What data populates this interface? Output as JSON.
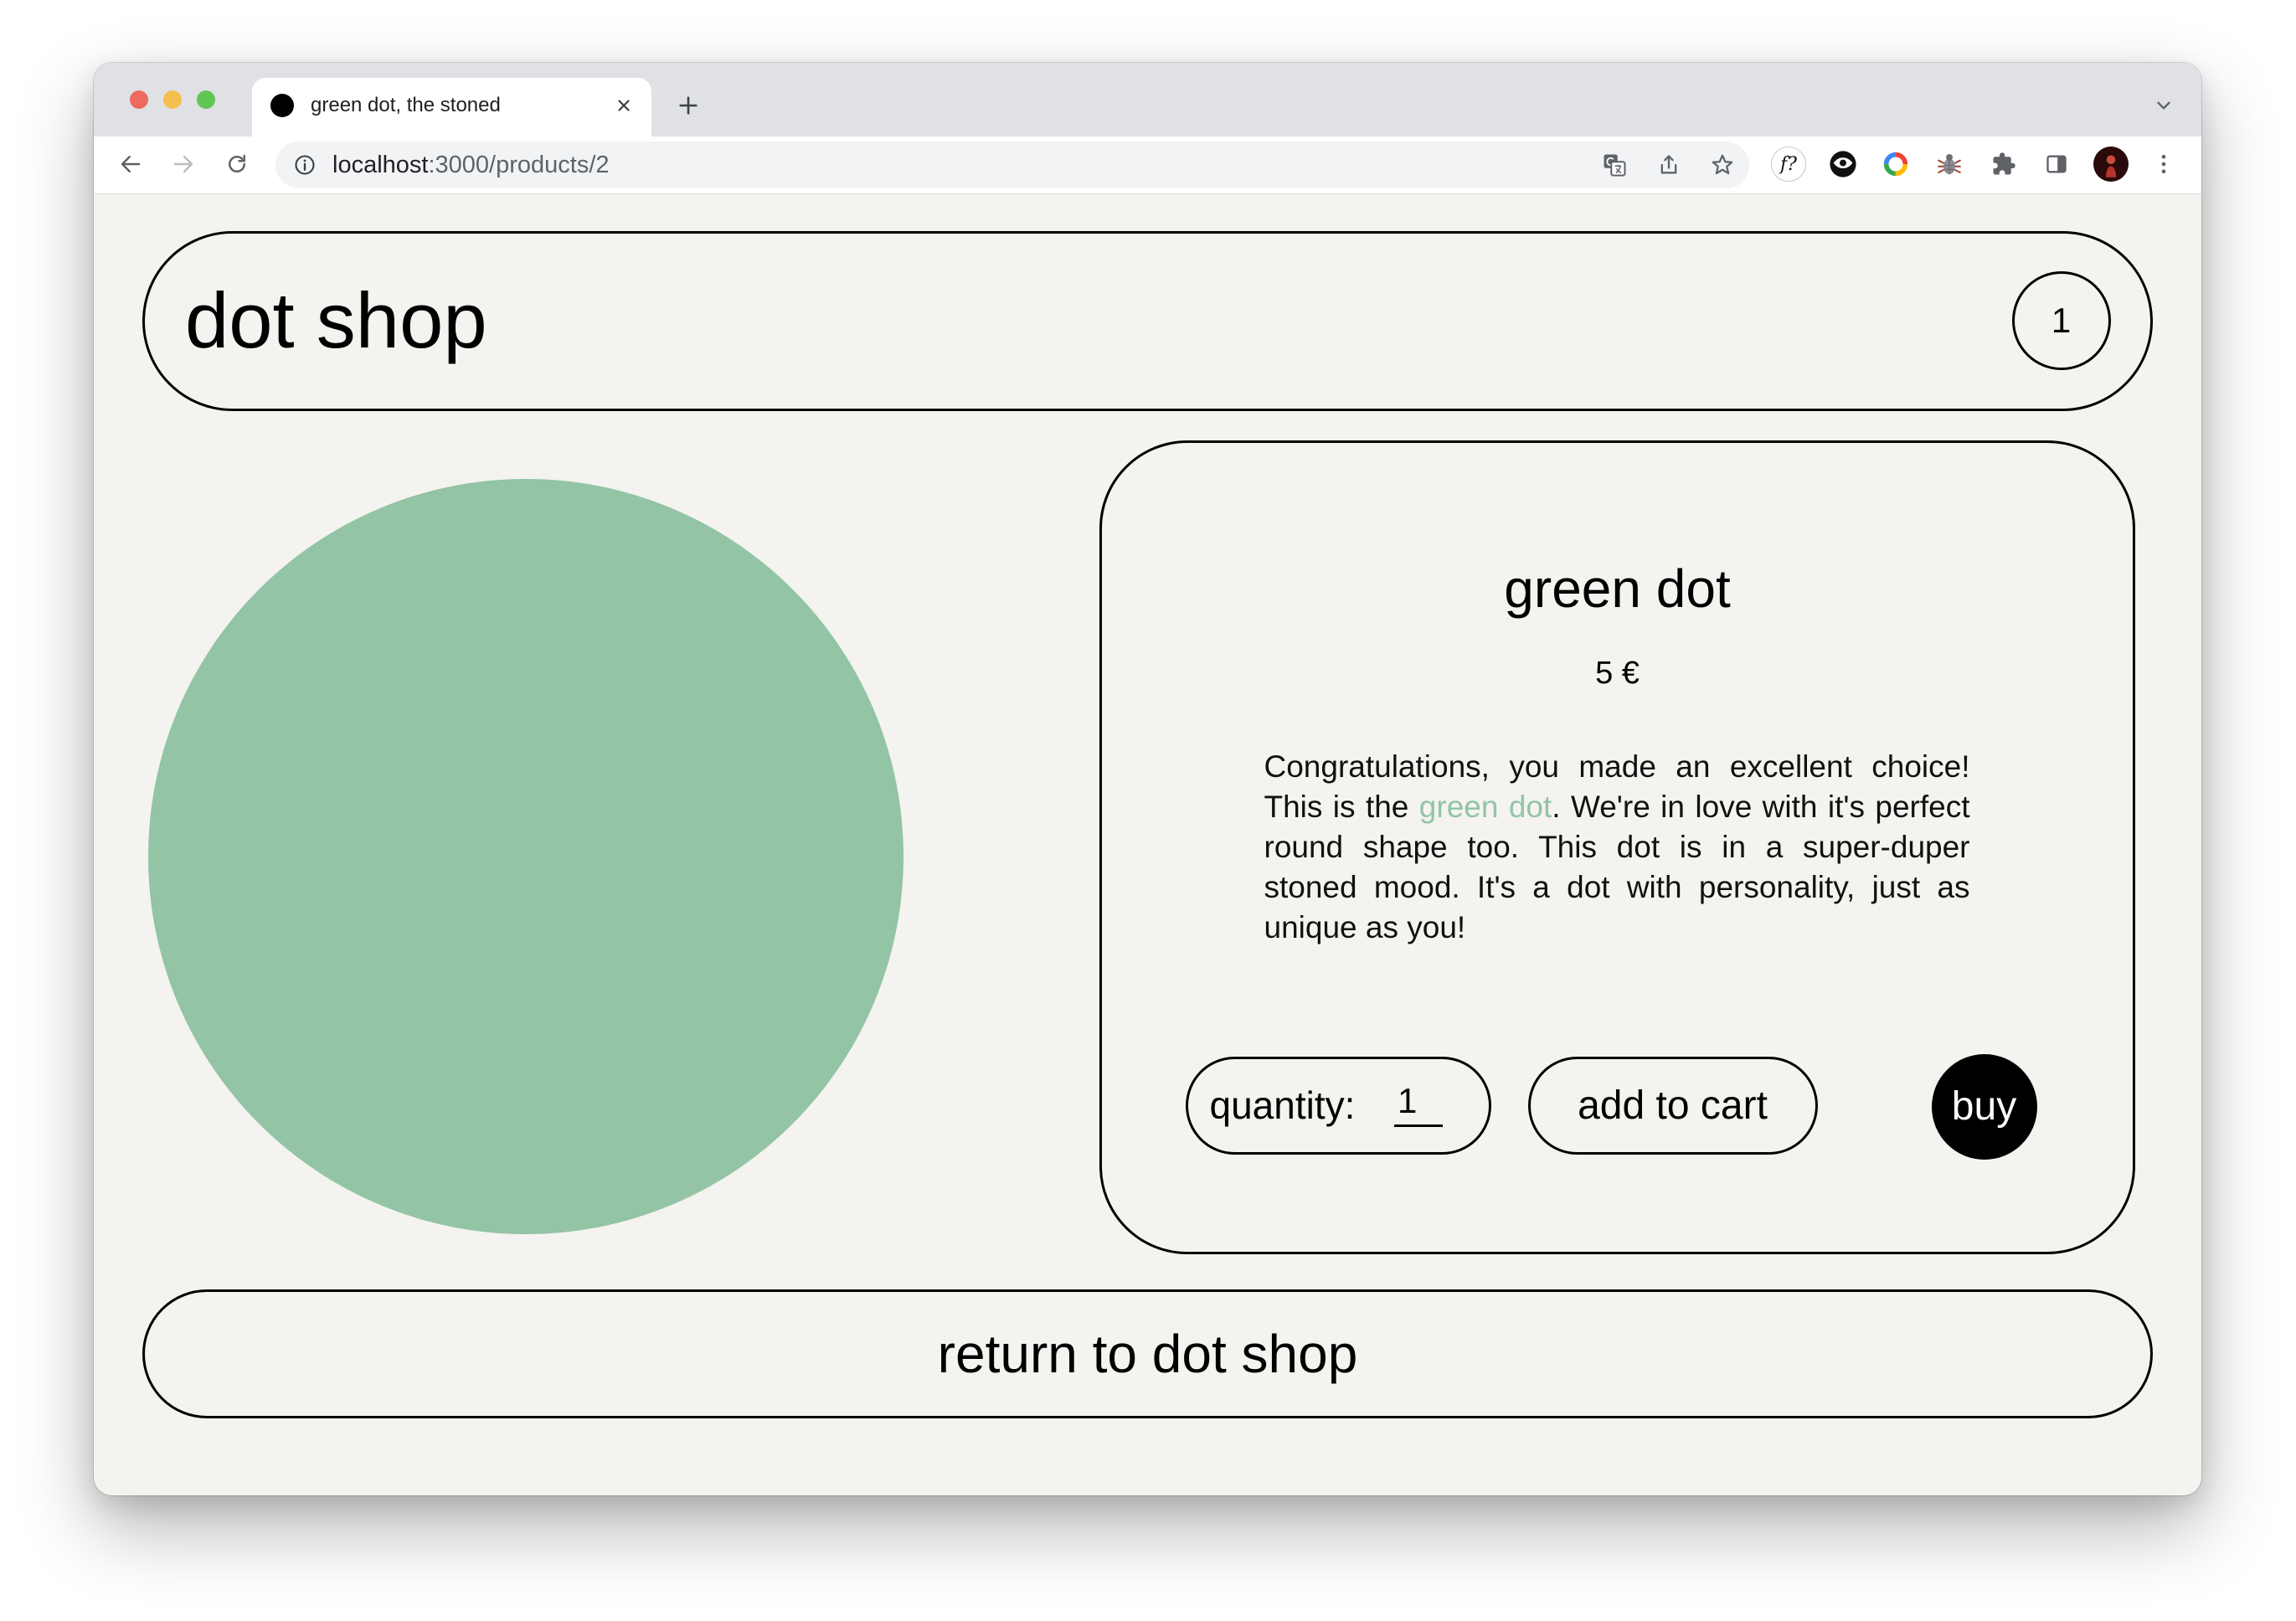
{
  "window": {
    "tab": {
      "title": "green dot, the stoned",
      "favicon_icon": "black-dot-icon",
      "close_icon": "close-icon"
    },
    "new_tab_icon": "plus-icon",
    "tab_search_icon": "chevron-down-icon",
    "toolbar": {
      "back_icon": "arrow-left-icon",
      "forward_icon": "arrow-right-icon",
      "reload_icon": "reload-icon",
      "address": {
        "site_info_icon": "info-icon",
        "host": "localhost",
        "rest": ":3000/products/2"
      },
      "address_actions": [
        "translate-icon",
        "share-icon",
        "star-icon"
      ],
      "extensions": [
        {
          "icon": "font-inspector-icon",
          "glyph": "f?"
        },
        {
          "icon": "eye-icon"
        },
        {
          "icon": "color-ring-icon"
        },
        {
          "icon": "bug-icon"
        },
        {
          "icon": "puzzle-icon"
        }
      ],
      "side_panel_icon": "side-panel-icon",
      "profile_icon": "avatar",
      "menu_icon": "kebab-menu-icon"
    }
  },
  "colors": {
    "page_background": "#f4f3ef",
    "accent_green": "#93c4a5",
    "ink": "#000000",
    "buy_text": "#ffffff"
  },
  "page": {
    "header": {
      "brand": "dot shop",
      "cart_count": "1"
    },
    "product": {
      "image_color": "#93c4a5",
      "name": "green dot",
      "price": "5 €",
      "description": {
        "before": "Congratulations, you made an excellent choice! This is the ",
        "highlight": "green dot",
        "after": ". We're in love with it's perfect round shape too. This dot is in a super-duper stoned mood. It's a dot with personality, just as unique as you!"
      },
      "quantity": {
        "label": "quantity:",
        "value": "1"
      },
      "add_to_cart_label": "add to cart",
      "buy_label": "buy"
    },
    "return_link": "return to dot shop"
  }
}
